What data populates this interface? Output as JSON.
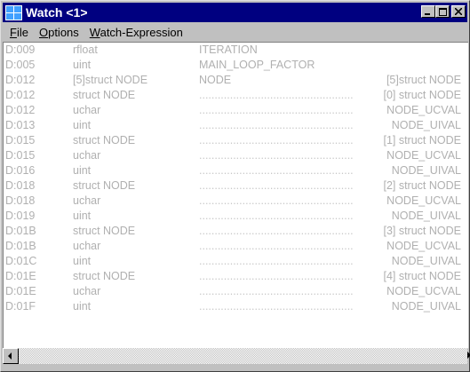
{
  "window": {
    "title": "Watch <1>"
  },
  "menu": [
    {
      "label": "File"
    },
    {
      "label": "Options"
    },
    {
      "label": "Watch-Expression"
    }
  ],
  "rows": [
    {
      "addr": "D:009",
      "type": "rfloat",
      "name": "ITERATION",
      "dots": "",
      "value": ""
    },
    {
      "addr": "D:005",
      "type": "uint",
      "name": "MAIN_LOOP_FACTOR",
      "dots": "",
      "value": ""
    },
    {
      "addr": "D:012",
      "type": "[5]struct NODE",
      "name": "NODE",
      "dots": "",
      "value": "[5]struct NODE"
    },
    {
      "addr": "D:012",
      "type": "struct NODE",
      "name": "",
      "dots": "..................................................",
      "value": "[0] struct NODE"
    },
    {
      "addr": "D:012",
      "type": "uchar",
      "name": "",
      "dots": "..................................................",
      "value": "NODE_UCVAL"
    },
    {
      "addr": "D:013",
      "type": "uint",
      "name": "",
      "dots": "..................................................",
      "value": "NODE_UIVAL"
    },
    {
      "addr": "D:015",
      "type": "struct NODE",
      "name": "",
      "dots": "..................................................",
      "value": "[1] struct NODE"
    },
    {
      "addr": "D:015",
      "type": "uchar",
      "name": "",
      "dots": "..................................................",
      "value": "NODE_UCVAL"
    },
    {
      "addr": "D:016",
      "type": "uint",
      "name": "",
      "dots": "..................................................",
      "value": "NODE_UIVAL"
    },
    {
      "addr": "D:018",
      "type": "struct NODE",
      "name": "",
      "dots": "..................................................",
      "value": "[2] struct NODE"
    },
    {
      "addr": "D:018",
      "type": "uchar",
      "name": "",
      "dots": "..................................................",
      "value": "NODE_UCVAL"
    },
    {
      "addr": "D:019",
      "type": "uint",
      "name": "",
      "dots": "..................................................",
      "value": "NODE_UIVAL"
    },
    {
      "addr": "D:01B",
      "type": "struct NODE",
      "name": "",
      "dots": "..................................................",
      "value": "[3] struct NODE"
    },
    {
      "addr": "D:01B",
      "type": "uchar",
      "name": "",
      "dots": "..................................................",
      "value": "NODE_UCVAL"
    },
    {
      "addr": "D:01C",
      "type": "uint",
      "name": "",
      "dots": "..................................................",
      "value": "NODE_UIVAL"
    },
    {
      "addr": "D:01E",
      "type": "struct NODE",
      "name": "",
      "dots": "..................................................",
      "value": "[4] struct NODE"
    },
    {
      "addr": "D:01E",
      "type": "uchar",
      "name": "",
      "dots": "..................................................",
      "value": "NODE_UCVAL"
    },
    {
      "addr": "D:01F",
      "type": "uint",
      "name": "",
      "dots": "..................................................",
      "value": "NODE_UIVAL"
    }
  ],
  "colors": {
    "titlebar": "#000080",
    "text_dim": "#b0b0b0",
    "chrome": "#c0c0c0"
  },
  "icons": [
    "app-icon",
    "minimize-icon",
    "maximize-icon",
    "close-icon",
    "scroll-left-icon",
    "scroll-right-icon"
  ]
}
